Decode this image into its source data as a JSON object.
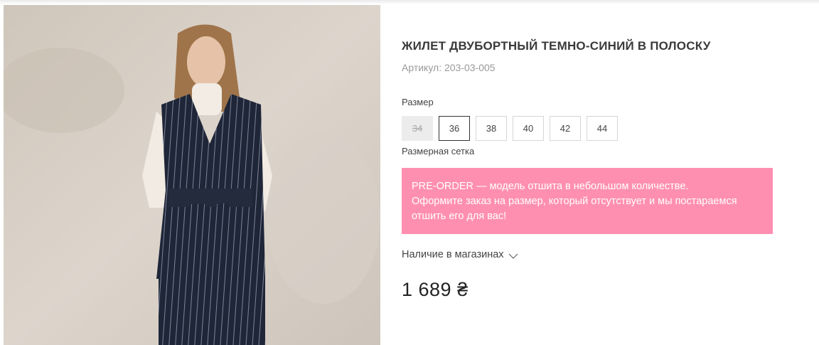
{
  "product": {
    "title": "ЖИЛЕТ ДВУБОРТНЫЙ ТЕМНО-СИНИЙ В ПОЛОСКУ",
    "sku_label": "Артикул:",
    "sku_value": "203-03-005",
    "price": "1 689 ₴"
  },
  "sizes": {
    "label": "Размер",
    "options": [
      {
        "value": "34",
        "state": "unavailable"
      },
      {
        "value": "36",
        "state": "selected"
      },
      {
        "value": "38",
        "state": "available"
      },
      {
        "value": "40",
        "state": "available"
      },
      {
        "value": "42",
        "state": "available"
      },
      {
        "value": "44",
        "state": "available"
      }
    ],
    "chart_link": "Размерная сетка"
  },
  "preorder": {
    "line1": "PRE-ORDER — модель отшита в небольшом количестве.",
    "line2": "Оформите заказ на размер, который отсутствует и мы постараемся",
    "line3": "отшить его для вас!",
    "background": "#ff8fb1"
  },
  "stores": {
    "label": "Наличие в магазинах",
    "icon": "chevron-down-icon"
  }
}
